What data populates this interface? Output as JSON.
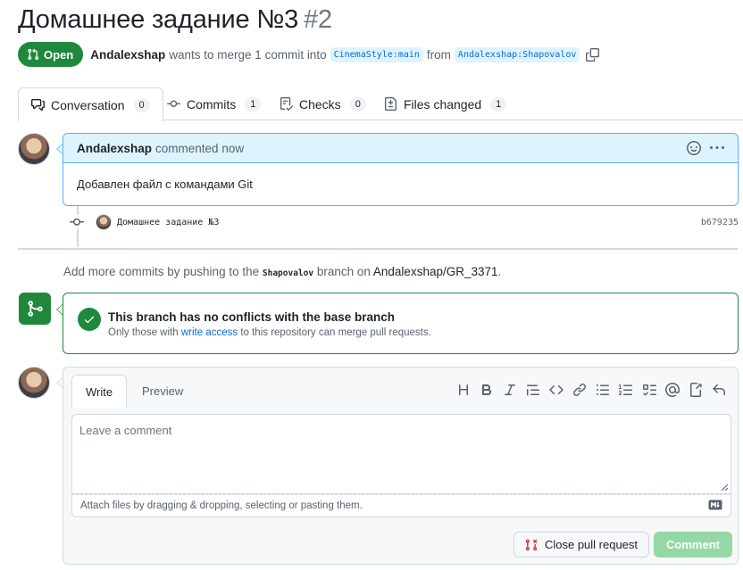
{
  "pr": {
    "title": "Домашнее задание №3",
    "number": "#2",
    "state": "Open",
    "author": "Andalexshap",
    "merge_text": "wants to merge 1 commit into",
    "base_branch": "CinemaStyle:main",
    "from_text": "from",
    "head_branch": "Andalexshap:Shapovalov"
  },
  "tabs": [
    {
      "label": "Conversation",
      "count": "0",
      "icon": "comment-discussion-icon"
    },
    {
      "label": "Commits",
      "count": "1",
      "icon": "git-commit-icon"
    },
    {
      "label": "Checks",
      "count": "0",
      "icon": "checklist-icon"
    },
    {
      "label": "Files changed",
      "count": "1",
      "icon": "file-diff-icon"
    }
  ],
  "comment": {
    "author": "Andalexshap",
    "meta": "commented now",
    "body": "Добавлен файл с командами Git"
  },
  "commit": {
    "message": "Домашнее задание №3",
    "sha": "b679235"
  },
  "push_note": {
    "prefix": "Add more commits by pushing to the",
    "branch": "Shapovalov",
    "middle": "branch on",
    "repo": "Andalexshap/GR_3371",
    "suffix": "."
  },
  "merge": {
    "title": "This branch has no conflicts with the base branch",
    "sub_prefix": "Only those with",
    "sub_link": "write access",
    "sub_suffix": "to this repository can merge pull requests."
  },
  "editor": {
    "write_tab": "Write",
    "preview_tab": "Preview",
    "placeholder": "Leave a comment",
    "attach_text": "Attach files by dragging & dropping, selecting or pasting them.",
    "toolbar": [
      "heading-icon",
      "bold-icon",
      "italic-icon",
      "quote-icon",
      "code-icon",
      "link-icon",
      "unordered-list-icon",
      "ordered-list-icon",
      "task-list-icon",
      "mention-icon",
      "cross-reference-icon",
      "undo-icon"
    ]
  },
  "buttons": {
    "close_pr": "Close pull request",
    "comment": "Comment"
  },
  "colors": {
    "open_green": "#1f883d",
    "link_blue": "#0969da",
    "comment_header_bg": "#ddf4ff",
    "comment_border": "#54aeff",
    "disabled_comment_btn": "#95d8a6",
    "close_icon_red": "#cf222e"
  }
}
